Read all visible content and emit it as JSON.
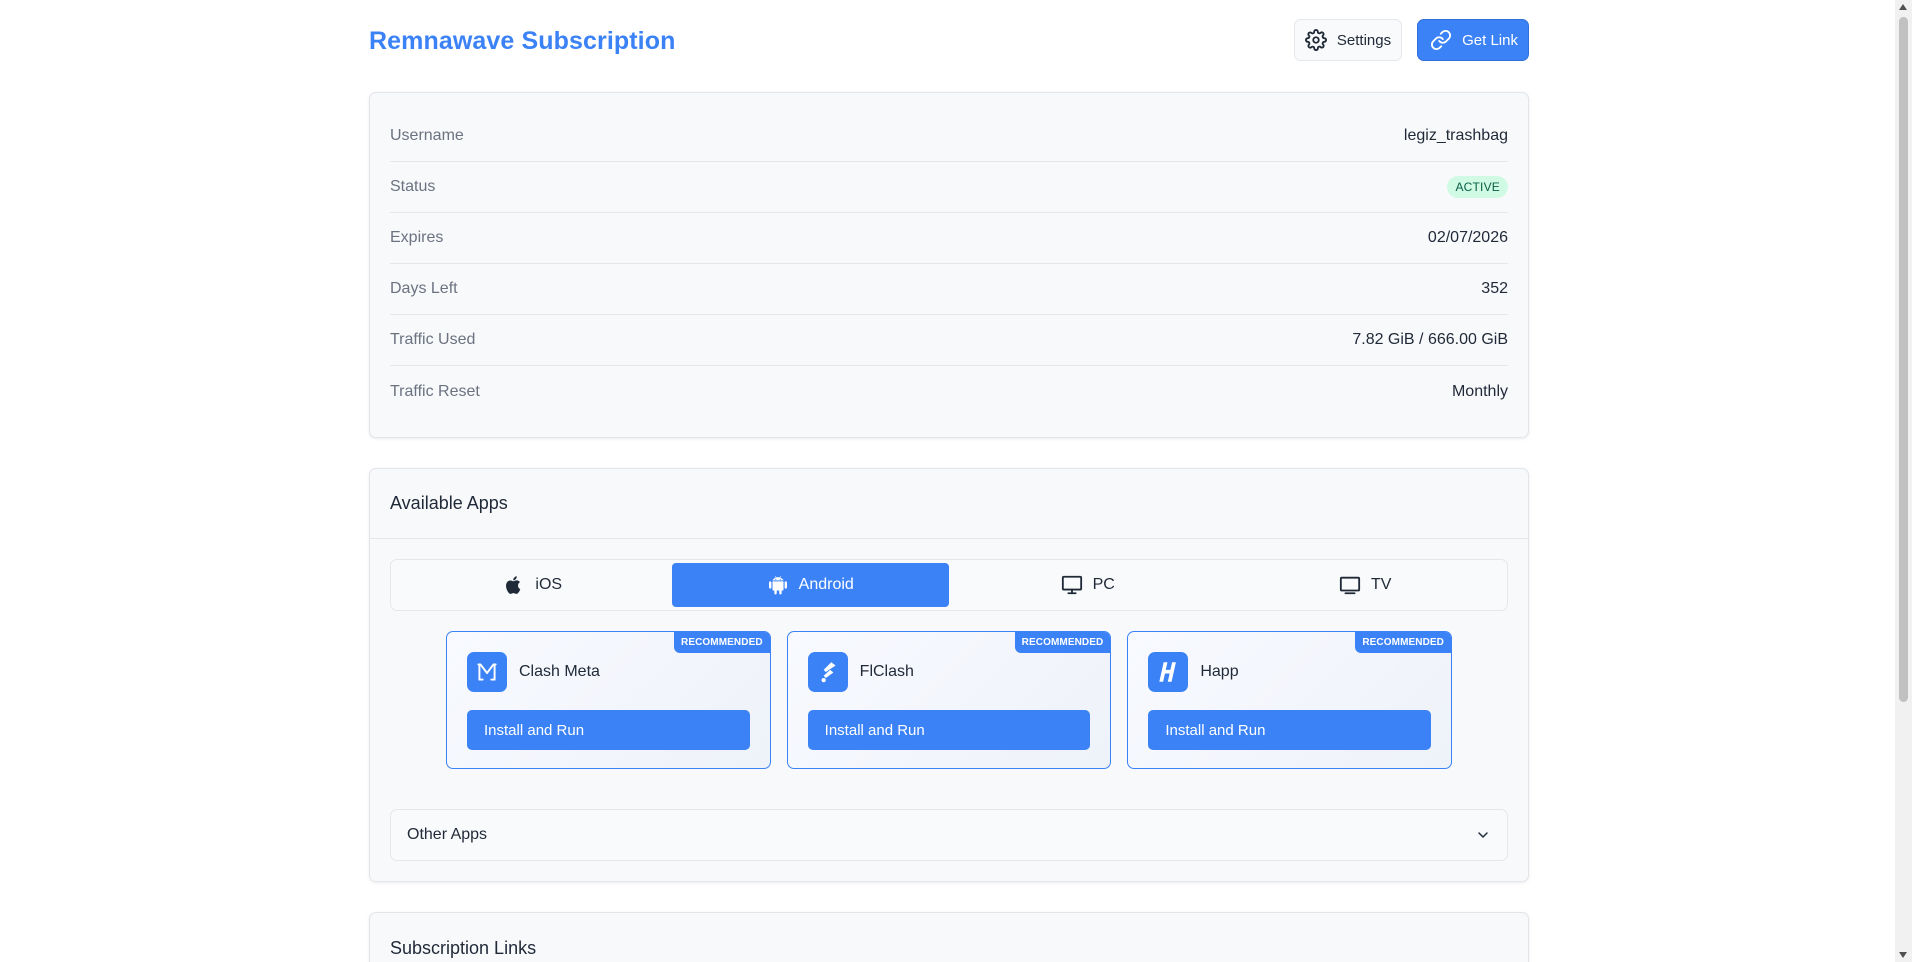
{
  "header": {
    "title": "Remnawave Subscription",
    "settings_label": "Settings",
    "get_link_label": "Get Link"
  },
  "info": {
    "rows": [
      {
        "label": "Username",
        "value": "legiz_trashbag"
      },
      {
        "label": "Status",
        "value": "ACTIVE"
      },
      {
        "label": "Expires",
        "value": "02/07/2026"
      },
      {
        "label": "Days Left",
        "value": "352"
      },
      {
        "label": "Traffic Used",
        "value": "7.82 GiB / 666.00 GiB"
      },
      {
        "label": "Traffic Reset",
        "value": "Monthly"
      }
    ]
  },
  "apps": {
    "title": "Available Apps",
    "tabs": [
      {
        "label": "iOS",
        "icon": "apple-icon",
        "active": false
      },
      {
        "label": "Android",
        "icon": "android-icon",
        "active": true
      },
      {
        "label": "PC",
        "icon": "monitor-icon",
        "active": false
      },
      {
        "label": "TV",
        "icon": "tv-icon",
        "active": false
      }
    ],
    "cards": [
      {
        "name": "Clash Meta",
        "badge": "RECOMMENDED",
        "button": "Install and Run",
        "icon": "clash-meta-icon"
      },
      {
        "name": "FlClash",
        "badge": "RECOMMENDED",
        "button": "Install and Run",
        "icon": "flclash-icon"
      },
      {
        "name": "Happ",
        "badge": "RECOMMENDED",
        "button": "Install and Run",
        "icon": "happ-icon"
      }
    ],
    "other_apps_label": "Other Apps"
  },
  "links": {
    "title": "Subscription Links"
  },
  "colors": {
    "accent": "#3b82f6",
    "status_bg": "#d1fae5",
    "status_text": "#065f46"
  }
}
